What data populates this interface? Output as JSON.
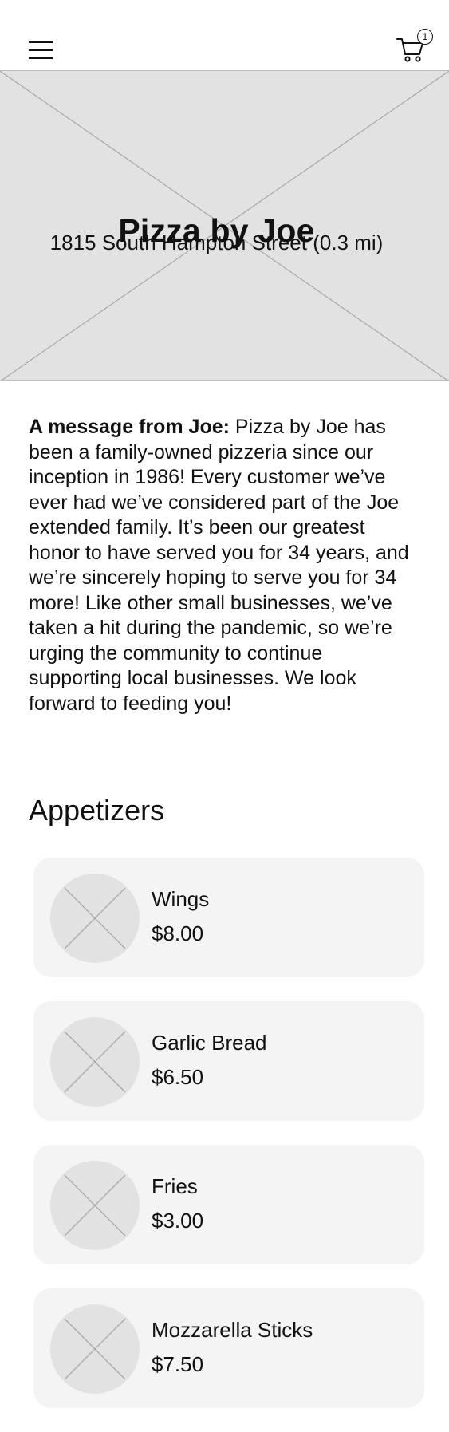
{
  "header": {
    "menu_icon": "hamburger-menu-icon",
    "cart_icon": "shopping-cart-icon",
    "cart_count": "1"
  },
  "hero": {
    "title": "Pizza by Joe",
    "subtitle": "1815 South Hampton Street (0.3 mi)",
    "image_placeholder": "image-placeholder-icon"
  },
  "message": {
    "lead": "A message from Joe:",
    "body": " Pizza by Joe has been a family-owned pizzeria since our inception in 1986! Every customer we’ve ever had we’ve considered part of the Joe extended family. It’s been our greatest honor to have served you for 34 years, and we’re sincerely hoping to serve you for 34 more! Like other small businesses, we’ve taken a hit during the pandemic, so we’re urging the community to continue supporting local businesses. We look forward to feeding you!"
  },
  "section": {
    "title": "Appetizers",
    "items": [
      {
        "name": "Wings",
        "price": "$8.00"
      },
      {
        "name": "Garlic Bread",
        "price": "$6.50"
      },
      {
        "name": "Fries",
        "price": "$3.00"
      },
      {
        "name": "Mozzarella Sticks",
        "price": "$7.50"
      }
    ]
  },
  "colors": {
    "placeholder_fill": "#e2e2e2",
    "card_background": "#f4f4f4",
    "text": "#111111"
  }
}
